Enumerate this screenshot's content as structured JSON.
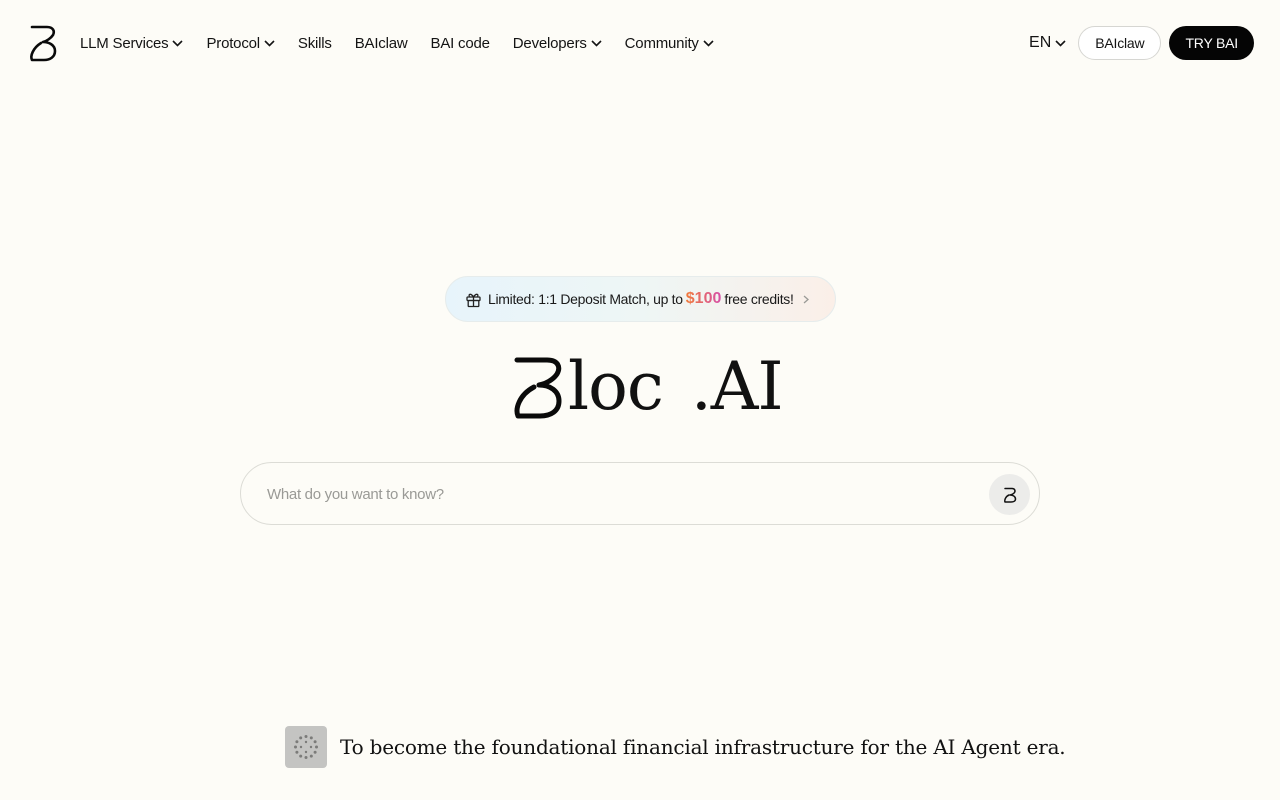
{
  "brand": {
    "logo_icon": "bloc-b-logo-icon"
  },
  "nav": {
    "items": [
      {
        "label": "LLM Services",
        "dropdown": true
      },
      {
        "label": "Protocol",
        "dropdown": true
      },
      {
        "label": "Skills",
        "dropdown": false
      },
      {
        "label": "BAIclaw",
        "dropdown": false
      },
      {
        "label": "BAI code",
        "dropdown": false
      },
      {
        "label": "Developers",
        "dropdown": true
      },
      {
        "label": "Community",
        "dropdown": true
      }
    ],
    "language": "EN",
    "secondary_button": "BAIclaw",
    "primary_button": "TRY BAI"
  },
  "promo": {
    "icon": "gift-icon",
    "text_before": "Limited: 1:1 Deposit Match, up to",
    "amount": "$100",
    "text_after": "free credits!",
    "amount_gradient": [
      "#f07a3a",
      "#d64fa8"
    ]
  },
  "hero": {
    "word_1": "loc",
    "word_2": ".AI"
  },
  "search": {
    "placeholder": "What do you want to know?",
    "value": "",
    "send_icon": "bloc-b-send-icon"
  },
  "tagline": {
    "icon": "spinner-dots-icon",
    "text": "To become the foundational financial infrastructure for the AI Agent era."
  },
  "colors": {
    "background": "#fdfcf7",
    "primary_button_bg": "#050505",
    "text": "#141414"
  }
}
